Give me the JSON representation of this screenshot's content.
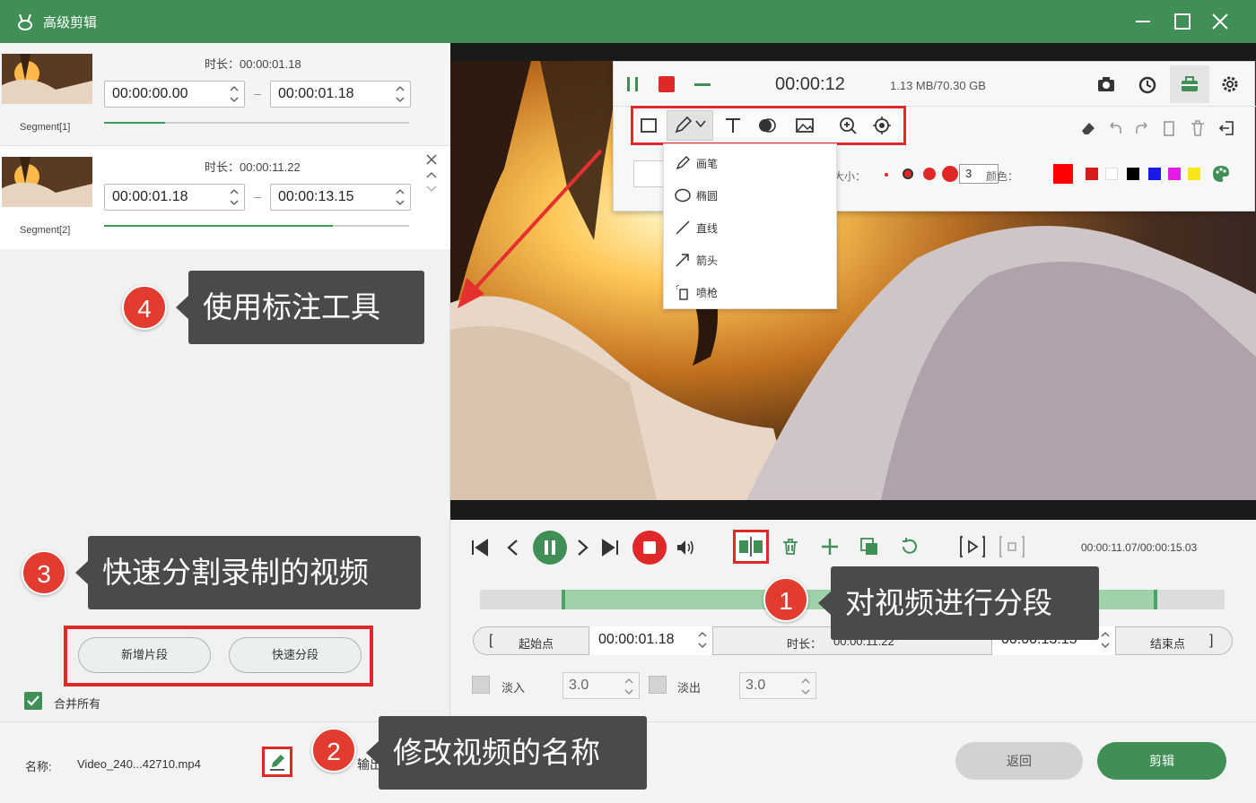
{
  "window": {
    "title": "高级剪辑",
    "controls": [
      "minimize-icon",
      "maximize-icon",
      "close-icon"
    ]
  },
  "segments": [
    {
      "label": "Segment[1]",
      "duration": "时长：00:00:01.18",
      "start": "00:00:00.00",
      "end": "00:00:01.18",
      "progress": 0.2
    },
    {
      "label": "Segment[2]",
      "duration": "时长：00:00:11.22",
      "start": "00:00:01.18",
      "end": "00:00:13.15",
      "progress": 0.75
    }
  ],
  "left_buttons": {
    "add_segment": "新增片段",
    "quick_split": "快速分段"
  },
  "merge": {
    "label": "合并所有",
    "checked": true
  },
  "bottom": {
    "name_label": "名称:",
    "name_value": "Video_240...42710.mp4",
    "output_label": "输出",
    "back": "返回",
    "cut": "剪辑"
  },
  "recorder": {
    "time": "00:00:12",
    "size": "1.13 MB/70.30 GB",
    "size_label": "大小：",
    "size_value": "3",
    "color_label": "颜色：",
    "colors": [
      "#ff0000",
      "#d91a1a",
      "#ffffff",
      "#000000",
      "#1a1ae6",
      "#e61ae6",
      "#f7e61a"
    ],
    "tools": [
      "rectangle-icon",
      "pen-icon",
      "text-icon",
      "blur-icon",
      "image-icon",
      "zoom-icon",
      "spotlight-icon"
    ],
    "dropdown": [
      "画笔",
      "椭圆",
      "直线",
      "箭头",
      "喷枪"
    ]
  },
  "controls": {
    "time_readout": "00:00:11.07/00:00:15.03",
    "start_label": "起始点",
    "start_time": "00:00:01.18",
    "duration_label": "时长：",
    "duration_value": "00:00:11.22",
    "end_time": "00:00:13.15",
    "end_label": "结束点",
    "fade_in_label": "淡入",
    "fade_in_value": "3.0",
    "fade_out_label": "淡出",
    "fade_out_value": "3.0",
    "selection_start": 0.11,
    "selection_end": 0.91,
    "playhead": 0.74
  },
  "callouts": [
    {
      "num": "1",
      "text": "对视频进行分段"
    },
    {
      "num": "2",
      "text": "修改视频的名称"
    },
    {
      "num": "3",
      "text": "快速分割录制的视频"
    },
    {
      "num": "4",
      "text": "使用标注工具"
    }
  ],
  "colors": {
    "brand_green": "#3f8f56",
    "callout_red": "#e23b2f",
    "frame_red": "#e02828"
  }
}
